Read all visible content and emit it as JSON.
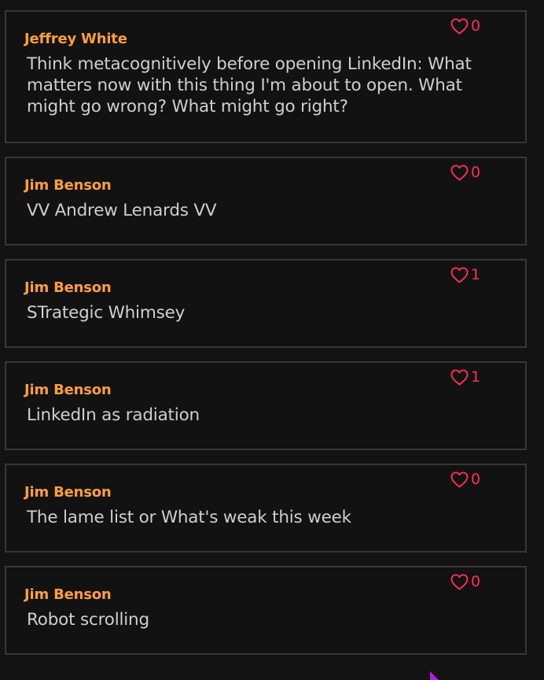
{
  "colors": {
    "background": "#131313",
    "card_background": "#121212",
    "card_border": "#373737",
    "author": "#ff9e3d",
    "text": "#cfcfcf",
    "like": "#ff2d55",
    "cursor": "#b01ee0"
  },
  "posts": [
    {
      "author": "Jeffrey White",
      "text": "Think metacognitively before opening LinkedIn: What matters now with this thing I'm about to open. What might go wrong? What might go right?",
      "likes": "0",
      "like_icon": "heart-outline-icon"
    },
    {
      "author": "Jim Benson",
      "text": "VV Andrew Lenards VV",
      "likes": "0",
      "like_icon": "heart-outline-icon"
    },
    {
      "author": "Jim Benson",
      "text": "STrategic Whimsey",
      "likes": "1",
      "like_icon": "heart-outline-icon"
    },
    {
      "author": "Jim Benson",
      "text": "LinkedIn as radiation",
      "likes": "1",
      "like_icon": "heart-outline-icon"
    },
    {
      "author": "Jim Benson",
      "text": "The lame list or What's weak this week",
      "likes": "0",
      "like_icon": "heart-outline-icon"
    },
    {
      "author": "Jim Benson",
      "text": "Robot scrolling",
      "likes": "0",
      "like_icon": "heart-outline-icon"
    }
  ],
  "cursor_icon": "mouse-pointer-icon"
}
